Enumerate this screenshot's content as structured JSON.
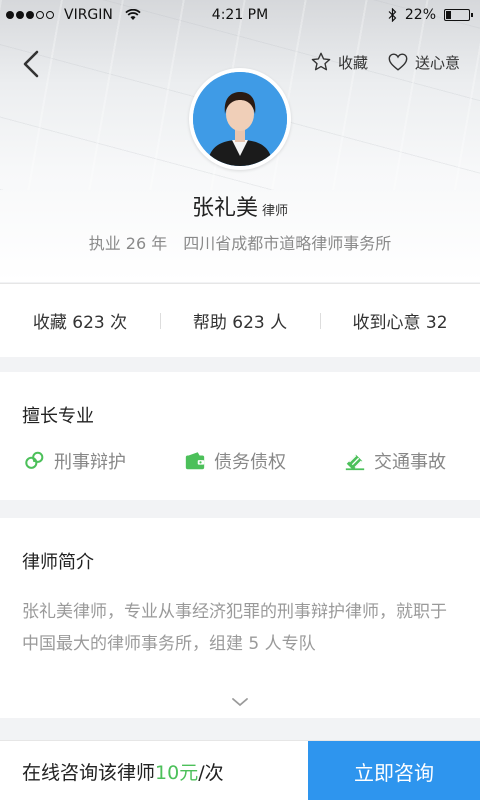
{
  "status_bar": {
    "carrier": "VIRGIN",
    "time": "4:21 PM",
    "battery": "22%",
    "battery_level": 0.22
  },
  "header": {
    "favorite_label": "收藏",
    "gift_label": "送心意",
    "lawyer_name": "张礼美",
    "lawyer_title": "律师",
    "years_label": "执业 26 年",
    "firm": "四川省成都市道略律师事务所"
  },
  "stats": [
    {
      "label": "收藏 623 次"
    },
    {
      "label": "帮助 623 人"
    },
    {
      "label": "收到心意 32"
    }
  ],
  "specialty": {
    "title": "擅长专业",
    "items": [
      {
        "label": "刑事辩护",
        "icon": "handcuffs-icon"
      },
      {
        "label": "债务债权",
        "icon": "wallet-icon"
      },
      {
        "label": "交通事故",
        "icon": "car-accident-icon"
      }
    ]
  },
  "intro": {
    "title": "律师简介",
    "text": "张礼美律师，专业从事经济犯罪的刑事辩护律师，就职于中国最大的律师事务所，组建 5 人专队"
  },
  "bottom": {
    "consult_prefix": "在线咨询该律师",
    "price": "10元",
    "unit": "/次",
    "button_label": "立即咨询"
  },
  "colors": {
    "accent_blue": "#2e95ee",
    "accent_green": "#4cc05a"
  }
}
